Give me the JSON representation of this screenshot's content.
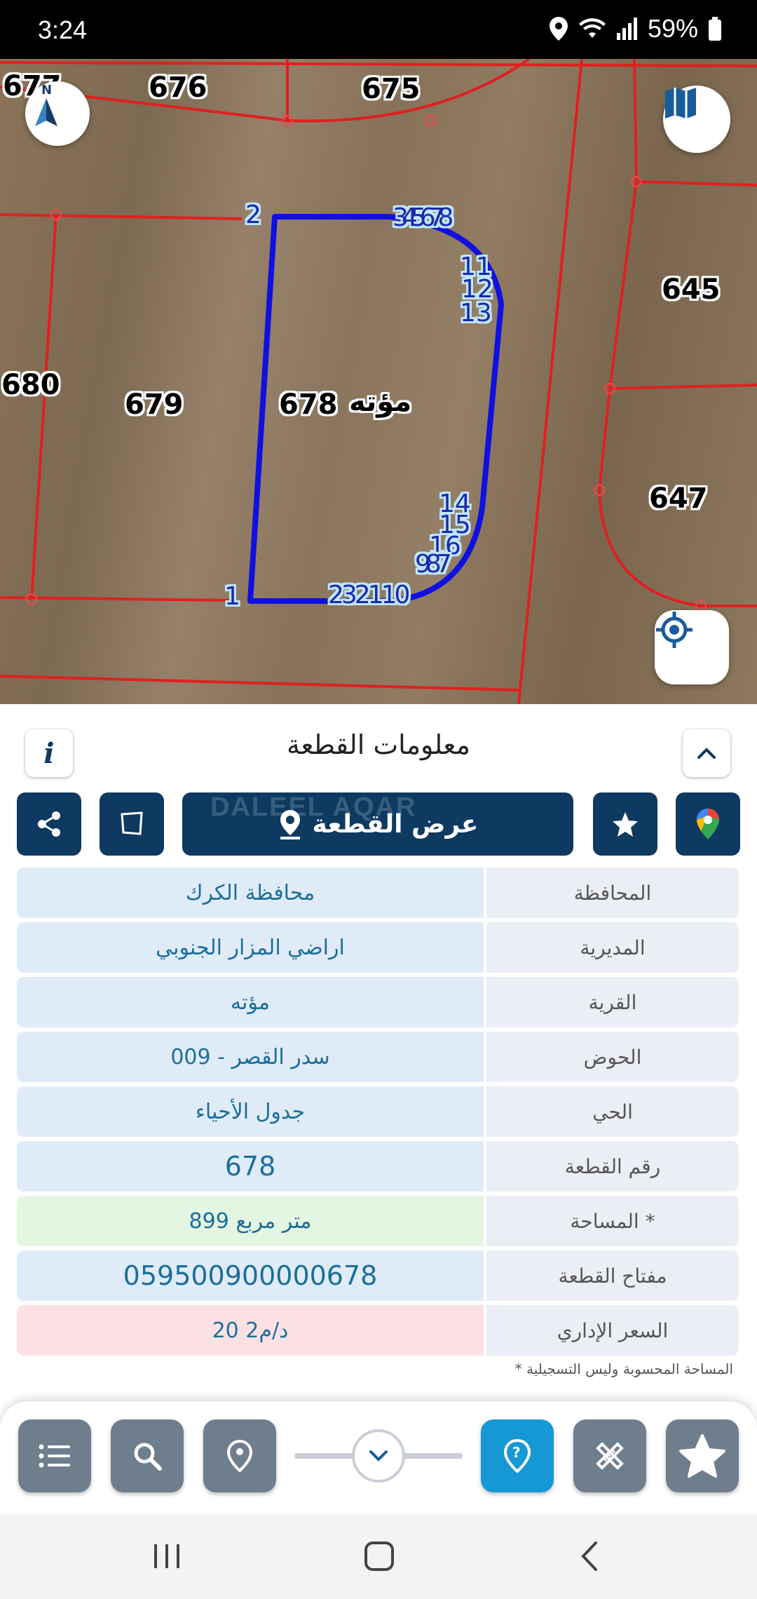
{
  "status": {
    "time": "3:24",
    "battery": "59%"
  },
  "map": {
    "parcels": [
      {
        "id": "p677",
        "label": "677"
      },
      {
        "id": "p676",
        "label": "676"
      },
      {
        "id": "p675",
        "label": "675"
      },
      {
        "id": "p645",
        "label": "645"
      },
      {
        "id": "p680",
        "label": "680"
      },
      {
        "id": "p679",
        "label": "679"
      },
      {
        "id": "p678",
        "label": "678"
      },
      {
        "id": "p647",
        "label": "647"
      }
    ],
    "village_label": "مؤته",
    "vertex_labels": {
      "v1": "1",
      "v2": "2",
      "top_cluster": "345678",
      "v11": "11",
      "v12": "12",
      "v13": "13",
      "v14": "14",
      "v15": "15",
      "v16": "16",
      "mid_cluster": "987",
      "bottom_cluster": "232110"
    },
    "icons": {
      "north": "north-arrow-icon",
      "map_layers": "map-book-icon",
      "locate": "my-location-icon"
    }
  },
  "sheet": {
    "title": "معلومات القطعة",
    "show_parcel_label": "عرض القطعة",
    "watermark": "DALEEL AQAR",
    "rows": [
      {
        "label": "المحافظة",
        "value": "محافظة الكرك",
        "tone": "blue"
      },
      {
        "label": "المديرية",
        "value": "اراضي المزار الجنوبي",
        "tone": "blue"
      },
      {
        "label": "القرية",
        "value": "مؤته",
        "tone": "blue"
      },
      {
        "label": "الحوض",
        "value": "سدر القصر - 009",
        "tone": "blue"
      },
      {
        "label": "الحي",
        "value": "جدول الأحياء",
        "tone": "blue"
      },
      {
        "label": "رقم القطعة",
        "value": "678",
        "tone": "blue",
        "big": true
      },
      {
        "label": "المساحة *",
        "value": "899  متر مربع",
        "tone": "green"
      },
      {
        "label": "مفتاح القطعة",
        "value": "059500900000678",
        "tone": "blue",
        "big": true
      },
      {
        "label": "السعر الإداري",
        "value": "20 د/م2",
        "tone": "red"
      }
    ],
    "footnote": "* المساحة المحسوبة وليس التسجيلية"
  },
  "colors": {
    "primary": "#0e3a61",
    "accent": "#1598d4",
    "parcel_outline": "#1010e0",
    "boundaries": "#e02020"
  }
}
